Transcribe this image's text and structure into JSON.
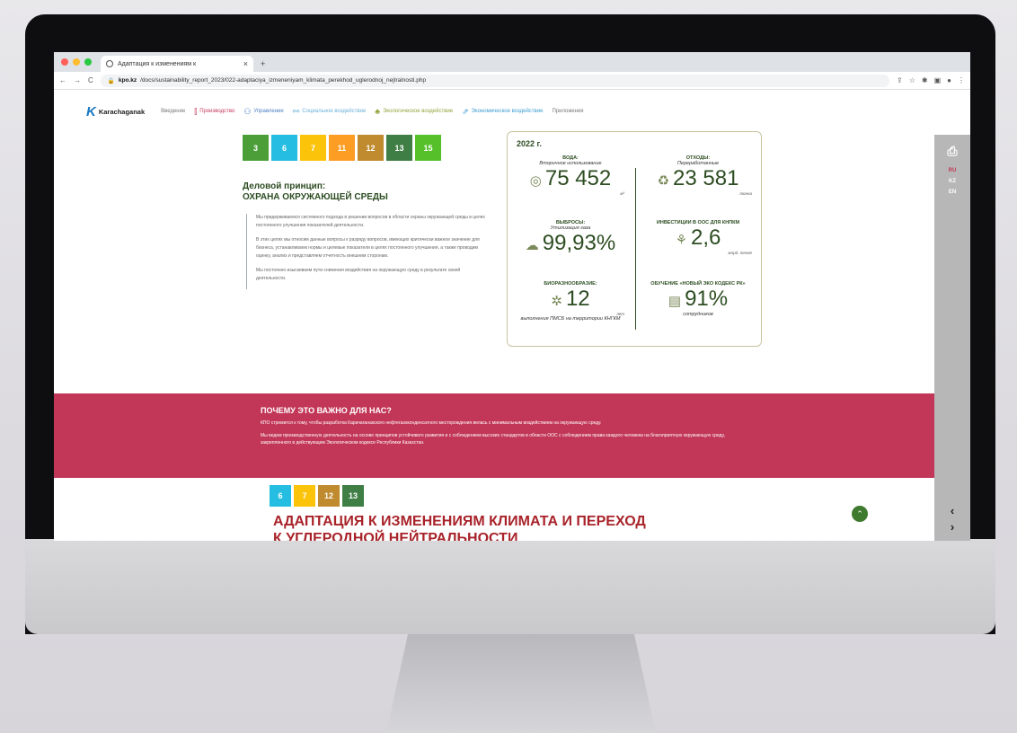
{
  "browser": {
    "tab_title": "Адаптация к изменениям к",
    "url_host": "kpo.kz",
    "url_path": "/docs/sustainability_report_2023/022-adaptaciya_izmeneniyam_klimata_perekhod_uglerodnoj_nejtralnosti.php"
  },
  "site": {
    "logo_letter": "K",
    "logo_name": "Karachaganak",
    "nav": [
      {
        "label": "Введение",
        "color": "#888888"
      },
      {
        "label": "Производство",
        "color": "#c23758"
      },
      {
        "label": "Управление",
        "color": "#4a7fc1"
      },
      {
        "label": "Социальное воздействие",
        "color": "#6ab0d8"
      },
      {
        "label": "Экологическое воздействие",
        "color": "#8fa43a"
      },
      {
        "label": "Экономическое воздействие",
        "color": "#3b9bd1"
      },
      {
        "label": "Приложения",
        "color": "#888888"
      }
    ]
  },
  "sdg_top": [
    {
      "num": "3",
      "color": "#4c9f38"
    },
    {
      "num": "6",
      "color": "#26bde2"
    },
    {
      "num": "7",
      "color": "#fcc30b"
    },
    {
      "num": "11",
      "color": "#fd9d24"
    },
    {
      "num": "12",
      "color": "#bf8b2e"
    },
    {
      "num": "13",
      "color": "#3f7e44"
    },
    {
      "num": "15",
      "color": "#56c02b"
    }
  ],
  "principle": {
    "line1": "Деловой принцип:",
    "line2": "ОХРАНА ОКРУЖАЮЩЕЙ СРЕДЫ",
    "p1": "Мы придерживаемся системного подхода в решении вопросов в области охраны окружающей среды в целях постоянного улучшения показателей деятельности.",
    "p2": "В этих целях мы относим данные вопросы к разряду вопросов, имеющих критически важное значение для бизнеса, устанавливаем нормы и целевые показатели в целях постоянного улучшения, а также проводим оценку, анализ и представляем отчетность внешним сторонам.",
    "p3": "Мы постоянно изыскиваем пути снижения воздействия на окружающую среду в результате своей деятельности."
  },
  "stats": {
    "year": "2022 г.",
    "water_h": "ВОДА:",
    "water_s": "Вторичное использование",
    "water_v": "75 452",
    "water_u": "м³",
    "waste_h": "ОТХОДЫ:",
    "waste_s": "Переработанные",
    "waste_v": "23 581",
    "waste_u": "тонна",
    "emis_h": "ВЫБРОСЫ:",
    "emis_s": "Утилизация газа",
    "emis_v": "99,93%",
    "inv_h": "ИНВЕСТИЦИИ В ООС ДЛЯ КНПКМ",
    "inv_v": "2,6",
    "inv_u": "млрд. тенге",
    "bio_h": "БИОРАЗНООБРАЗИЕ:",
    "bio_v": "12",
    "bio_u": "лет",
    "bio_s": "выполнения ПМСБ на территории КНГКМ",
    "edu_h": "ОБУЧЕНИЕ «НОВЫЙ ЭКО КОДЕКС РК»",
    "edu_v": "91%",
    "edu_s": "сотрудников"
  },
  "band": {
    "title": "ПОЧЕМУ ЭТО ВАЖНО ДЛЯ НАС?",
    "p1": "КПО стремится к тому, чтобы разработка Карачаганакского нефтегазоконденсатного месторождения велась с минимальным воздействием на окружающую среду.",
    "p2": "Мы ведем производственную деятельность на основе принципов устойчивого развития и с соблюдением высоких стандартов в области ООС с соблюдением права каждого человека на благоприятную окружающую среду, закрепленного в действующем Экологическом кодексе Республики Казахстан."
  },
  "sdg_bottom": [
    {
      "num": "6",
      "color": "#26bde2"
    },
    {
      "num": "7",
      "color": "#fcc30b"
    },
    {
      "num": "12",
      "color": "#bf8b2e"
    },
    {
      "num": "13",
      "color": "#3f7e44"
    }
  ],
  "climate": {
    "line1": "АДАПТАЦИЯ К ИЗМЕНЕНИЯМ КЛИМАТА И ПЕРЕХОД",
    "line2": "К УГЛЕРОДНОЙ НЕЙТРАЛЬНОСТИ"
  },
  "rail": {
    "lang_ru": "RU",
    "lang_kz": "KZ",
    "lang_en": "EN"
  }
}
